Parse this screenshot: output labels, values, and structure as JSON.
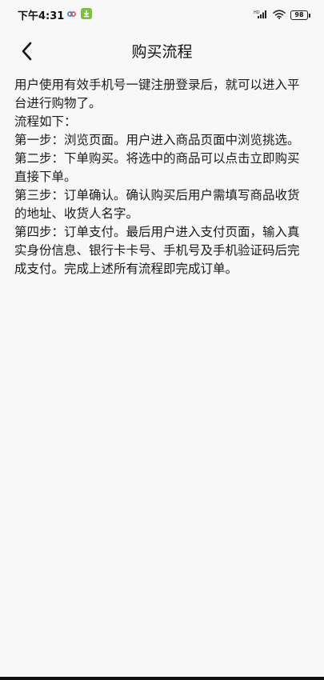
{
  "status_bar": {
    "time": "下午4:31",
    "battery_level": "98"
  },
  "header": {
    "title": "购买流程"
  },
  "content": {
    "intro": "用户使用有效手机号一键注册登录后，就可以进入平台进行购物了。",
    "flow_label": "流程如下：",
    "steps": [
      "第一步：浏览页面。用户进入商品页面中浏览挑选。",
      "第二步：下单购买。将选中的商品可以点击立即购买直接下单。",
      "第三步：订单确认。确认购买后用户需填写商品收货的地址、收货人名字。",
      "第四步：订单支付。最后用户进入支付页面，输入真实身份信息、银行卡卡号、手机号及手机验证码后完成支付。完成上述所有流程即完成订单。"
    ]
  }
}
